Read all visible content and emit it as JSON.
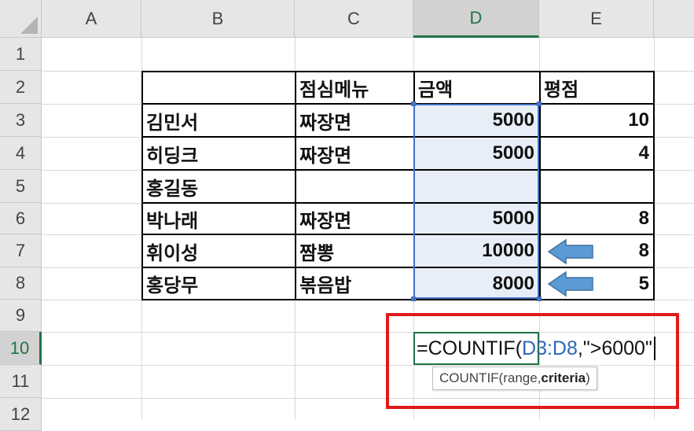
{
  "columns": [
    {
      "label": "A"
    },
    {
      "label": "B"
    },
    {
      "label": "C"
    },
    {
      "label": "D"
    },
    {
      "label": "E"
    }
  ],
  "rows": [
    {
      "label": "1"
    },
    {
      "label": "2"
    },
    {
      "label": "3"
    },
    {
      "label": "4"
    },
    {
      "label": "5"
    },
    {
      "label": "6"
    },
    {
      "label": "7"
    },
    {
      "label": "8"
    },
    {
      "label": "9"
    },
    {
      "label": "10"
    },
    {
      "label": "11"
    },
    {
      "label": "12"
    }
  ],
  "table": {
    "headers": {
      "menu": "점심메뉴",
      "amount": "금액",
      "rating": "평점"
    },
    "records": [
      {
        "name": "김민서",
        "menu": "짜장면",
        "amount": "5000",
        "rating": "10"
      },
      {
        "name": "히딩크",
        "menu": "짜장면",
        "amount": "5000",
        "rating": "4"
      },
      {
        "name": "홍길동",
        "menu": "",
        "amount": "",
        "rating": ""
      },
      {
        "name": "박나래",
        "menu": "짜장면",
        "amount": "5000",
        "rating": "8"
      },
      {
        "name": "휘이성",
        "menu": "짬뽕",
        "amount": "10000",
        "rating": "8"
      },
      {
        "name": "홍당무",
        "menu": "볶음밥",
        "amount": "8000",
        "rating": "5"
      }
    ]
  },
  "formula": {
    "prefix": "=COUNTIF(",
    "range_ref": "D3:D8",
    "suffix": ",\">6000\""
  },
  "tooltip": {
    "text_before": "COUNTIF(range, ",
    "bold_arg": "criteria",
    "text_after": ")"
  },
  "colors": {
    "range_highlight": "#4472c4",
    "selected_header": "#217346",
    "callout_box": "#e01a1a",
    "arrow_fill": "#5b9bd5"
  },
  "icons": [
    "select-all-triangle",
    "left-arrow-icon",
    "left-arrow-icon"
  ]
}
